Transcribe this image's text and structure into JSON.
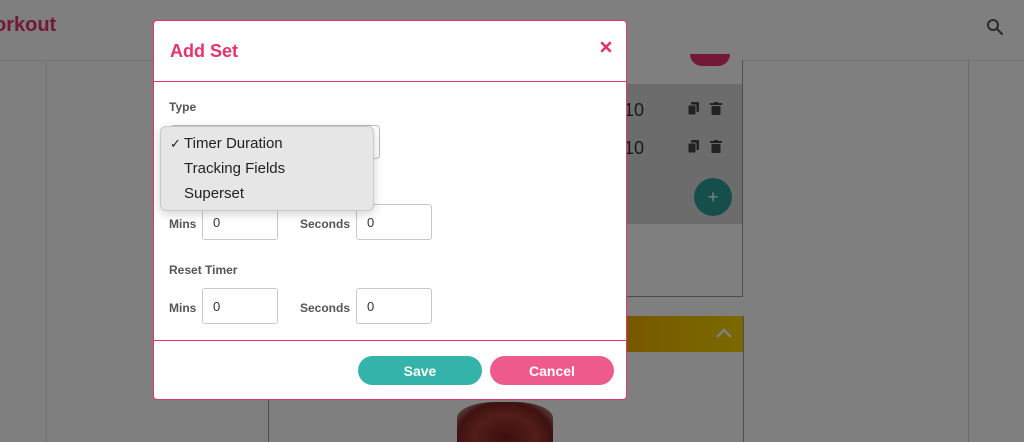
{
  "app": {
    "title": "orkout"
  },
  "background": {
    "reps": [
      "10",
      "10"
    ],
    "add_label": "+"
  },
  "modal": {
    "title": "Add Set",
    "type_label": "Type",
    "type_options": [
      {
        "label": "Timer Duration",
        "selected": true
      },
      {
        "label": "Tracking Fields",
        "selected": false
      },
      {
        "label": "Superset",
        "selected": false
      }
    ],
    "timer": {
      "mins_label": "Mins",
      "mins_value": "0",
      "seconds_label": "Seconds",
      "seconds_value": "0"
    },
    "reset_timer": {
      "label": "Reset Timer",
      "mins_label": "Mins",
      "mins_value": "0",
      "seconds_label": "Seconds",
      "seconds_value": "0"
    },
    "save_label": "Save",
    "cancel_label": "Cancel"
  },
  "colors": {
    "accent": "#e8326b",
    "save": "#33b3a9",
    "cancel": "#ef5a8c",
    "teal": "#2a9d96"
  },
  "icons": [
    "search-icon",
    "copy-icon",
    "trash-icon",
    "close-icon",
    "chevron-up-icon",
    "checkmark-icon"
  ]
}
